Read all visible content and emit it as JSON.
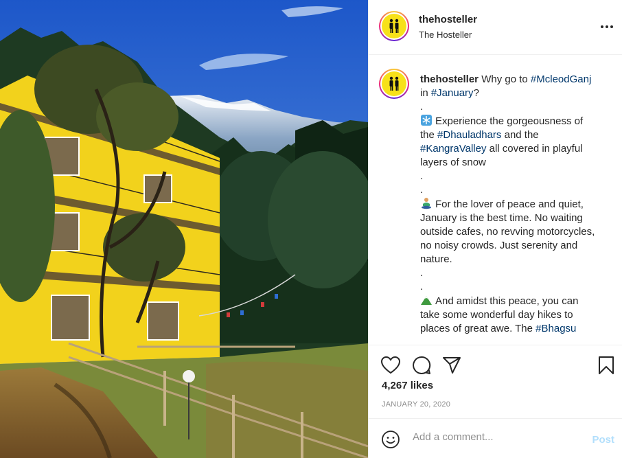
{
  "post": {
    "username": "thehosteller",
    "full_name": "The Hosteller",
    "more_icon": "more-horizontal-icon",
    "avatar_icon": "hosteller-logo-icon",
    "photo_alt": "Yellow hostel building among trees with snowy mountains"
  },
  "caption": {
    "username": "thehosteller",
    "intro": "Why go to ",
    "tag_mcleodganj": "#McleodGanj",
    "in": "in ",
    "tag_january": "#January",
    "q": "?",
    "dot": ".",
    "p1_a": "Experience the gorgeousness of",
    "p1_b": "the ",
    "tag_dhauladhars": "#Dhauladhars",
    "p1_c": " and the",
    "tag_kangra": "#KangraValley",
    "p1_d": " all covered in playful",
    "p1_e": "layers of snow",
    "p2_a": "For the lover of peace and quiet,",
    "p2_b": "January is the best time. No waiting",
    "p2_c": "outside cafes, no revving motorcycles,",
    "p2_d": "no noisy crowds. Just serenity and",
    "p2_e": "nature.",
    "p3_a": "And amidst this peace, you can",
    "p3_b": "take some wonderful day hikes to",
    "p3_c": "places of great awe. The ",
    "tag_bhagsu": "#Bhagsu",
    "emoji1": "snowflake-icon",
    "emoji2": "person-meditating-icon",
    "emoji3": "mountain-icon"
  },
  "actions": {
    "like_icon": "heart-icon",
    "comment_icon": "comment-icon",
    "share_icon": "paper-plane-icon",
    "save_icon": "bookmark-icon"
  },
  "likes": "4,267 likes",
  "date": "JANUARY 20, 2020",
  "comment": {
    "placeholder": "Add a comment...",
    "post_label": "Post",
    "emoji_icon": "smiley-icon"
  },
  "colors": {
    "hashtag": "#00376b",
    "post_disabled": "#b2dffc",
    "meta_gray": "#8e8e8e",
    "border": "#efefef"
  }
}
